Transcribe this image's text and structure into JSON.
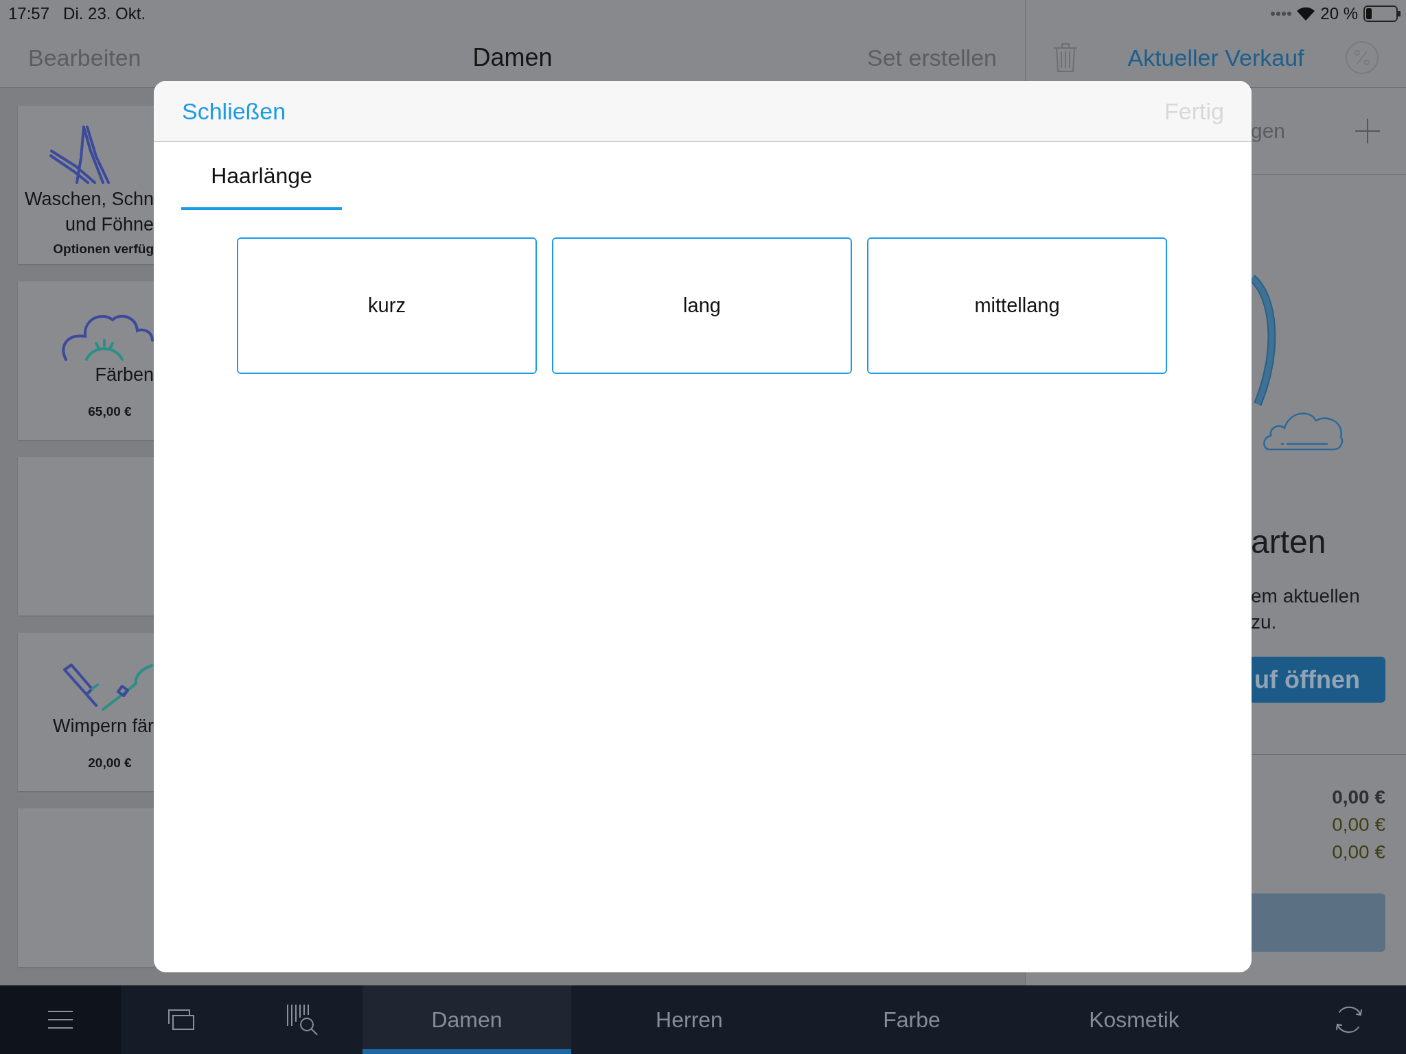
{
  "status_bar": {
    "time": "17:57",
    "date": "Di. 23. Okt.",
    "battery": "20 %"
  },
  "nav_bar": {
    "left_button": "Bearbeiten",
    "title": "Damen",
    "right_button": "Set erstellen"
  },
  "products": [
    {
      "kind": "service",
      "name_lines": [
        "Waschen, Schn",
        "und Föhne"
      ],
      "note": "Optionen verfüg"
    },
    {
      "kind": "service",
      "name_lines": [
        "Färben"
      ],
      "price": "65,00 €"
    },
    {
      "kind": "empty"
    },
    {
      "kind": "service",
      "name_lines": [
        "Wimpern fär"
      ],
      "price": "20,00 €"
    },
    {
      "kind": "empty"
    }
  ],
  "sale_panel": {
    "title": "Aktueller Verkauf",
    "add_row": "gen",
    "empty_title": "arten",
    "empty_text": [
      "em aktuellen",
      "zu."
    ],
    "open_button": "uf öffnen",
    "totals": [
      {
        "kind": "total",
        "value": "0,00 €"
      },
      {
        "kind": "sub",
        "value": "0,00 €"
      },
      {
        "kind": "sub",
        "value": "0,00 €"
      }
    ]
  },
  "modal": {
    "close_button": "Schließen",
    "done_button": {
      "label": "Fertig",
      "disabled": true
    },
    "tabs": [
      {
        "label": "Haarlänge",
        "selected": true
      }
    ],
    "options": [
      {
        "label": "kurz",
        "selected": false
      },
      {
        "label": "lang",
        "selected": false
      },
      {
        "label": "mittellang",
        "selected": false
      }
    ]
  },
  "tab_bar": {
    "tabs": [
      {
        "label": "Damen",
        "selected": true
      },
      {
        "label": "Herren",
        "selected": false
      },
      {
        "label": "Farbe",
        "selected": false
      },
      {
        "label": "Kosmetik",
        "selected": false
      }
    ]
  }
}
